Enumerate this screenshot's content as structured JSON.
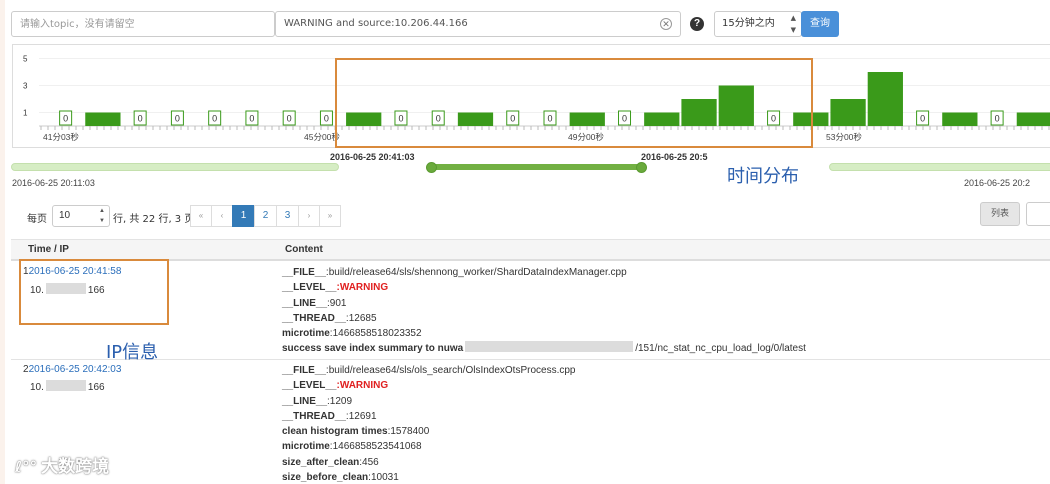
{
  "toolbar": {
    "topic_placeholder": "请输入topic，没有请留空",
    "query_value": "WARNING and source:10.206.44.166",
    "clear_icon": "✕",
    "help_icon": "?",
    "time_range": "15分钟之内",
    "query_button": "查询"
  },
  "chart_data": {
    "type": "bar",
    "yticks": [
      5,
      3,
      1
    ],
    "ylim": [
      0,
      5
    ],
    "xtick_labels": [
      "41分03秒",
      "45分00秒",
      "49分00秒",
      "53分00秒"
    ],
    "bar_color": "#3a9a1a",
    "values": [
      0,
      1,
      0,
      0,
      0,
      0,
      0,
      0,
      1,
      0,
      0,
      1,
      0,
      0,
      1,
      0,
      1,
      2,
      3,
      0,
      1,
      2,
      4,
      0,
      1,
      0,
      1
    ],
    "zero_labels": [
      "0",
      "0",
      "0",
      "0",
      "0",
      "0",
      "0",
      "0",
      "0",
      "0",
      "0",
      "0"
    ]
  },
  "slider": {
    "start_label": "2016-06-25 20:41:03",
    "end_label": "2016-06-25 20:5",
    "range_min": "2016-06-25 20:11:03",
    "range_max": "2016-06-25 20:2"
  },
  "pager": {
    "per_page_label": "每页",
    "per_page_value": "10",
    "summary": "行, 共 22 行, 3 页",
    "first": "«",
    "prev": "‹",
    "pages": [
      "1",
      "2",
      "3"
    ],
    "next": "›",
    "last": "»",
    "view_list": "列表"
  },
  "table": {
    "col_time": "Time / IP",
    "col_content": "Content",
    "rows": [
      {
        "index": "1",
        "time": "2016-06-25 20:41:58",
        "ip_prefix": "10.",
        "ip_suffix": "166",
        "lines": [
          {
            "key": "__FILE__",
            "value": ":build/release64/sls/shennong_worker/ShardDataIndexManager.cpp"
          },
          {
            "key": "__LEVEL__",
            "value": ":WARNING"
          },
          {
            "key": "__LINE__",
            "value": ":901"
          },
          {
            "key": "__THREAD__",
            "value": ":12685"
          },
          {
            "key": "microtime",
            "value": ":1466858518023352"
          },
          {
            "key": "success save index summary to nuwa",
            "value": "/151/nc_stat_nc_cpu_load_log/0/latest"
          }
        ]
      },
      {
        "index": "2",
        "time": "2016-06-25 20:42:03",
        "ip_prefix": "10.",
        "ip_suffix": "166",
        "lines": [
          {
            "key": "__FILE__",
            "value": ":build/release64/sls/ols_search/OlsIndexOtsProcess.cpp"
          },
          {
            "key": "__LEVEL__",
            "value": ":WARNING"
          },
          {
            "key": "__LINE__",
            "value": ":1209"
          },
          {
            "key": "__THREAD__",
            "value": ":12691"
          },
          {
            "key": "clean histogram times",
            "value": ":1578400"
          },
          {
            "key": "microtime",
            "value": ":1466858523541068"
          },
          {
            "key": "size_after_clean",
            "value": ":456"
          },
          {
            "key": "size_before_clean",
            "value": ":10031"
          }
        ]
      }
    ]
  },
  "annotations": {
    "time_distribution": "时间分布",
    "ip_info": "IP信息"
  },
  "watermark": {
    "logo": "ℓ°°",
    "text": "大数跨境"
  }
}
